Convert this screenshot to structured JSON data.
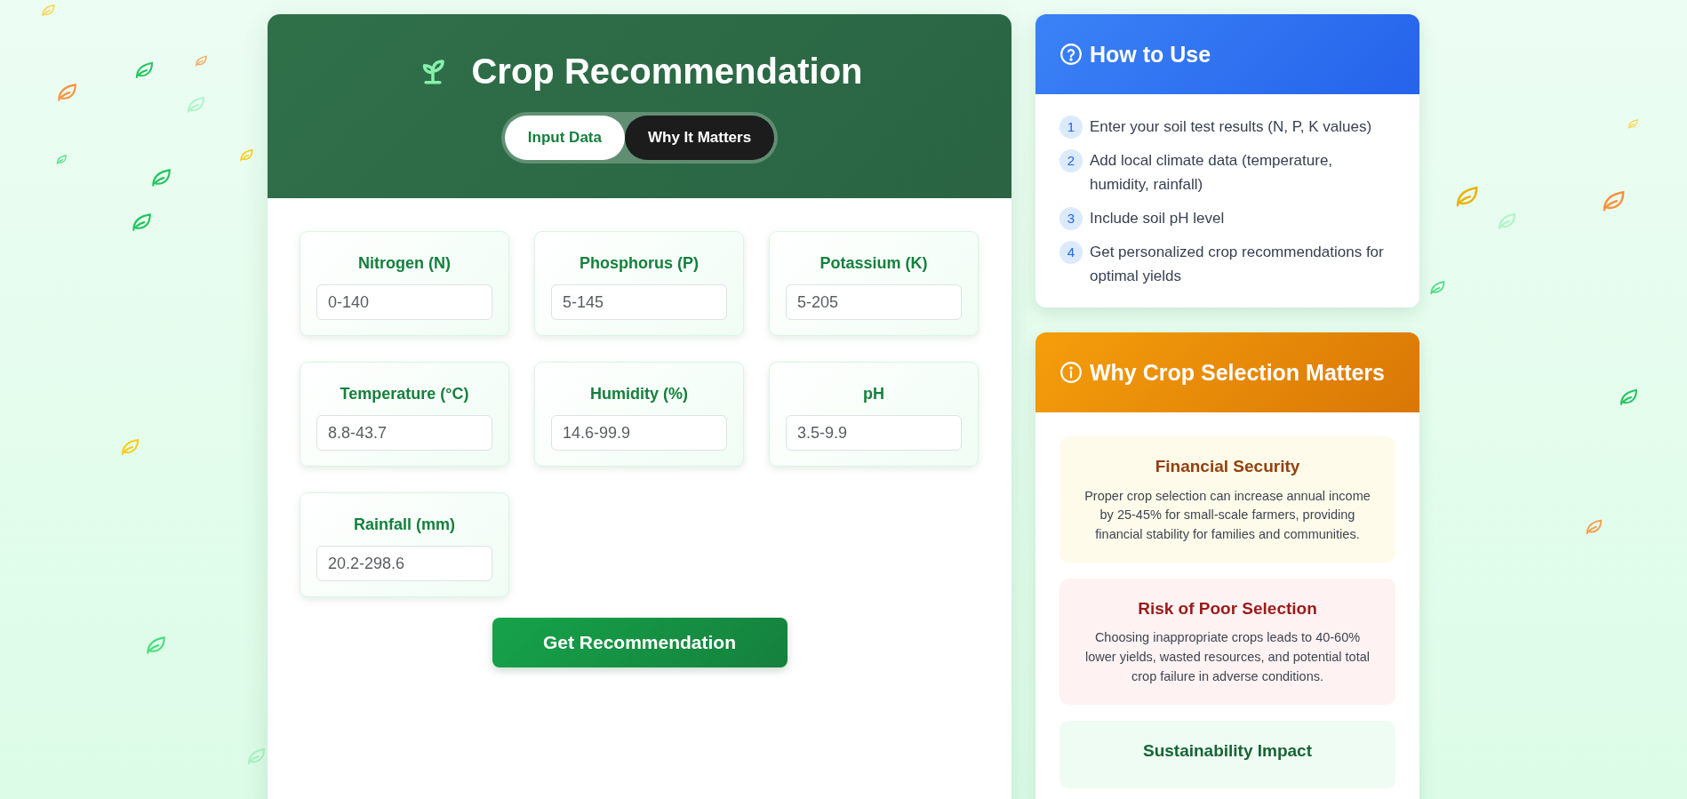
{
  "header": {
    "title": "Crop Recommendation"
  },
  "tabs": [
    {
      "label": "Input Data",
      "selected": true
    },
    {
      "label": "Why It Matters",
      "selected": false
    }
  ],
  "fields": [
    {
      "label": "Nitrogen (N)",
      "placeholder": "0-140"
    },
    {
      "label": "Phosphorus (P)",
      "placeholder": "5-145"
    },
    {
      "label": "Potassium (K)",
      "placeholder": "5-205"
    },
    {
      "label": "Temperature (°C)",
      "placeholder": "8.8-43.7"
    },
    {
      "label": "Humidity (%)",
      "placeholder": "14.6-99.9"
    },
    {
      "label": "pH",
      "placeholder": "3.5-9.9"
    },
    {
      "label": "Rainfall (mm)",
      "placeholder": "20.2-298.6"
    }
  ],
  "submit_button": "Get Recommendation",
  "how_to_use": {
    "title": "How to Use",
    "steps": [
      {
        "number": "1",
        "text": "Enter your soil test results (N, P, K values)"
      },
      {
        "number": "2",
        "text": "Add local climate data (temperature, humidity, rainfall)"
      },
      {
        "number": "3",
        "text": "Include soil pH level"
      },
      {
        "number": "4",
        "text": "Get personalized crop recommendations for optimal yields"
      }
    ]
  },
  "why_matters": {
    "title": "Why Crop Selection Matters",
    "cards": [
      {
        "kind": "finance",
        "title": "Financial Security",
        "text": "Proper crop selection can increase annual income by 25-45% for small-scale farmers, providing financial stability for families and communities."
      },
      {
        "kind": "risk",
        "title": "Risk of Poor Selection",
        "text": "Choosing inappropriate crops leads to 40-60% lower yields, wasted resources, and potential total crop failure in adverse conditions."
      },
      {
        "kind": "sustainability",
        "title": "Sustainability Impact"
      }
    ]
  }
}
